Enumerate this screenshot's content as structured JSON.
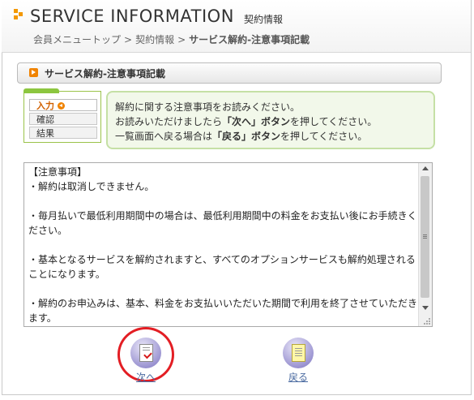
{
  "header": {
    "title": "SERVICE INFORMATION",
    "subtitle": "契約情報",
    "breadcrumb": [
      "会員メニュートップ",
      "契約情報",
      "サービス解約-注意事項記載"
    ],
    "breadcrumb_separator": ">"
  },
  "section": {
    "title": "サービス解約-注意事項記載",
    "icon": "arrow-right-icon"
  },
  "steps": [
    {
      "label": "入力",
      "state": "current"
    },
    {
      "label": "確認",
      "state": "pending"
    },
    {
      "label": "結果",
      "state": "pending"
    }
  ],
  "notice": {
    "line1": "解約に関する注意事項をお読みください。",
    "line2_before": "お読みいただけましたら",
    "line2_emph": "「次へ」ボタン",
    "line2_after": "を押してください。",
    "line3_before": "一覧画面へ戻る場合は",
    "line3_emph": "「戻る」ボタン",
    "line3_after": "を押してください。"
  },
  "terms": {
    "text": "【注意事項】\n・解約は取消しできません。\n\n・毎月払いで最低利用期間中の場合は、最低利用期間中の料金をお支払い後にお手続きください。\n\n・基本となるサービスを解約されますと、すべてのオプションサービスも解約処理されることになります。\n\n・解約のお申込みは、基本、料金をお支払いいただいた期間で利用を終了させていただきます。"
  },
  "buttons": {
    "next_label": "次へ",
    "back_label": "戻る"
  },
  "colors": {
    "accent_orange": "#f08300",
    "notice_bg": "#f2f8ea",
    "notice_border": "#c5e0a5",
    "step_border": "#9bc34a",
    "link": "#4a6aa0",
    "highlight_ring": "#e31e24"
  }
}
